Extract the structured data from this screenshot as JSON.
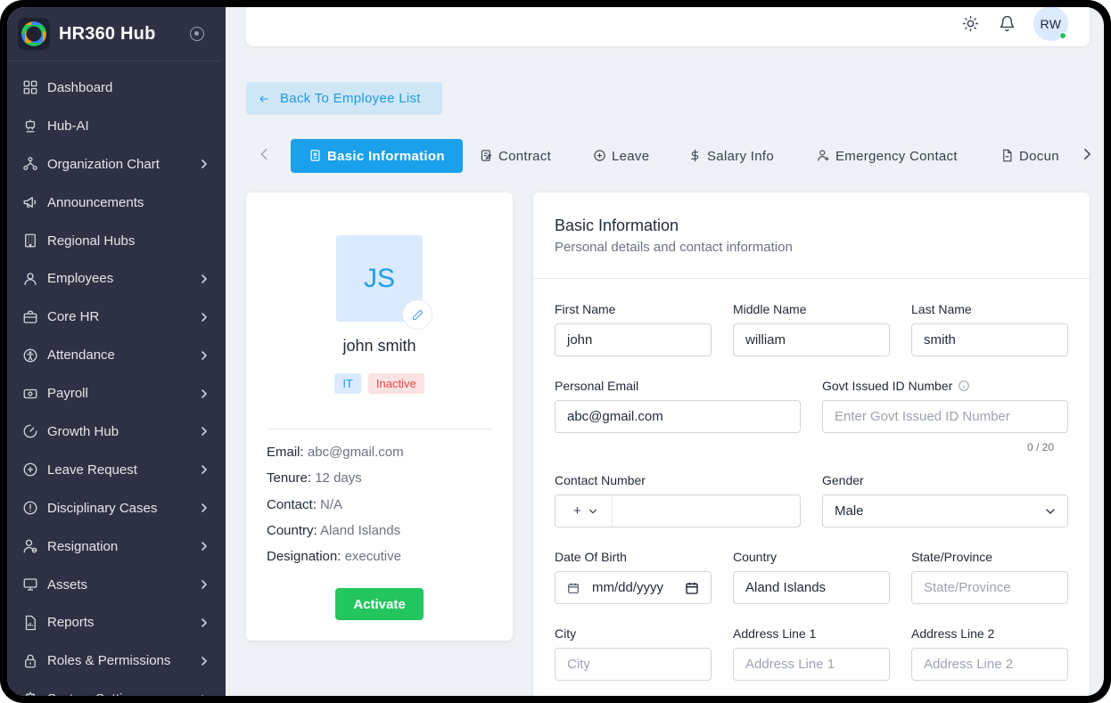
{
  "app": {
    "name": "HR360 Hub"
  },
  "sidebar": {
    "items": [
      {
        "label": "Dashboard",
        "icon": "dashboard-icon",
        "chevron": false
      },
      {
        "label": "Hub-AI",
        "icon": "robot-icon",
        "chevron": false
      },
      {
        "label": "Organization Chart",
        "icon": "org-chart-icon",
        "chevron": true
      },
      {
        "label": "Announcements",
        "icon": "megaphone-icon",
        "chevron": false
      },
      {
        "label": "Regional Hubs",
        "icon": "building-icon",
        "chevron": false
      },
      {
        "label": "Employees",
        "icon": "user-icon",
        "chevron": true
      },
      {
        "label": "Core HR",
        "icon": "briefcase-icon",
        "chevron": true
      },
      {
        "label": "Attendance",
        "icon": "accessibility-icon",
        "chevron": true
      },
      {
        "label": "Payroll",
        "icon": "money-icon",
        "chevron": true
      },
      {
        "label": "Growth Hub",
        "icon": "gauge-icon",
        "chevron": true
      },
      {
        "label": "Leave Request",
        "icon": "plus-circle-icon",
        "chevron": true
      },
      {
        "label": "Disciplinary Cases",
        "icon": "alert-circle-icon",
        "chevron": true
      },
      {
        "label": "Resignation",
        "icon": "user-minus-icon",
        "chevron": true
      },
      {
        "label": "Assets",
        "icon": "monitor-icon",
        "chevron": true
      },
      {
        "label": "Reports",
        "icon": "report-icon",
        "chevron": true
      },
      {
        "label": "Roles & Permissions",
        "icon": "lock-icon",
        "chevron": true
      },
      {
        "label": "System Settings",
        "icon": "settings-icon",
        "chevron": true
      }
    ]
  },
  "topbar": {
    "avatar_initials": "RW",
    "online_color": "#22c55e"
  },
  "back_button": {
    "label": "Back To Employee List"
  },
  "tabs": [
    {
      "label": "Basic Information",
      "icon": "id-card-icon",
      "active": true
    },
    {
      "label": "Contract",
      "icon": "contract-icon",
      "active": false
    },
    {
      "label": "Leave",
      "icon": "plus-circle-icon",
      "active": false
    },
    {
      "label": "Salary Info",
      "icon": "dollar-icon",
      "active": false
    },
    {
      "label": "Emergency Contact",
      "icon": "user-plus-icon",
      "active": false
    },
    {
      "label": "Docun",
      "icon": "document-icon",
      "active": false
    }
  ],
  "profile": {
    "initials": "JS",
    "name": "john smith",
    "department": "IT",
    "status": "Inactive",
    "email_label": "Email:",
    "email": "abc@gmail.com",
    "tenure_label": "Tenure:",
    "tenure": "12 days",
    "contact_label": "Contact:",
    "contact": "N/A",
    "country_label": "Country:",
    "country": "Aland Islands",
    "designation_label": "Designation:",
    "designation": "executive",
    "activate_label": "Activate"
  },
  "form": {
    "title": "Basic Information",
    "subtitle": "Personal details and contact information",
    "first_name": {
      "label": "First Name",
      "value": "john"
    },
    "middle_name": {
      "label": "Middle Name",
      "value": "william"
    },
    "last_name": {
      "label": "Last Name",
      "value": "smith"
    },
    "personal_email": {
      "label": "Personal Email",
      "value": "abc@gmail.com"
    },
    "govt_id": {
      "label": "Govt Issued ID Number",
      "placeholder": "Enter Govt Issued ID Number",
      "counter": "0 / 20"
    },
    "contact_number": {
      "label": "Contact Number",
      "prefix": "+"
    },
    "gender": {
      "label": "Gender",
      "value": "Male"
    },
    "dob": {
      "label": "Date Of Birth",
      "placeholder": "mm/dd/yyyy"
    },
    "country": {
      "label": "Country",
      "value": "Aland Islands"
    },
    "state": {
      "label": "State/Province",
      "placeholder": "State/Province"
    },
    "city": {
      "label": "City",
      "placeholder": "City"
    },
    "address1": {
      "label": "Address Line 1",
      "placeholder": "Address Line 1"
    },
    "address2": {
      "label": "Address Line 2",
      "placeholder": "Address Line 2"
    }
  },
  "colors": {
    "accent": "#1ba0ec",
    "sidebar_bg": "#2d3143",
    "activate": "#22c55e",
    "inactive": "#ef4444"
  }
}
